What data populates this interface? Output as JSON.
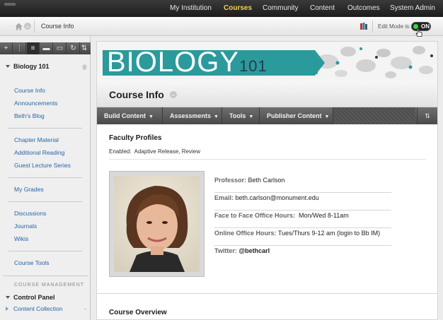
{
  "topnav": {
    "items": [
      "My Institution",
      "Courses",
      "Community",
      "Content",
      "Outcomes",
      "System Admin"
    ],
    "active_index": 1
  },
  "breadcrumb": {
    "title": "Course Info",
    "edit_mode_label": "Edit Mode is:",
    "edit_mode_state": "ON"
  },
  "sidebar": {
    "course_name": "Biology 101",
    "groups": [
      [
        "Course Info",
        "Announcements",
        "Beth's Blog"
      ],
      [
        "Chapter Material",
        "Additional Reading",
        "Guest Lecture Series"
      ],
      [
        "My Grades"
      ],
      [
        "Discussions",
        "Journals",
        "Wikis"
      ],
      [
        "Course Tools"
      ]
    ],
    "course_management_label": "COURSE MANAGEMENT",
    "control_panel": "Control Panel",
    "content_collection": "Content Collection"
  },
  "banner": {
    "title": "BIOLOGY",
    "number": "101"
  },
  "page": {
    "title": "Course Info",
    "actions": [
      "Build Content",
      "Assessments",
      "Tools",
      "Publisher Content"
    ],
    "faculty_title": "Faculty Profiles",
    "enabled_label": "Enabled:",
    "enabled_value": "Adaptive Release, Review",
    "overview_title": "Course Overview"
  },
  "profile": {
    "rows": [
      {
        "label": "Professor:",
        "value": "Beth Carlson"
      },
      {
        "label": "Email:",
        "value": "beth.carlson@monument.edu"
      },
      {
        "label": "Face to Face Office Hours:",
        "value": "Mon/Wed 8-11am"
      },
      {
        "label": "Online Office Hours:",
        "value": "Tues/Thurs 9-12 am (login to Bb IM)"
      },
      {
        "label": "Twitter:",
        "value": "@bethcarl"
      }
    ]
  },
  "colors": {
    "accent": "#f7d34a",
    "teal": "#2b9a9c",
    "link": "#2566a8",
    "toggle_on": "#39d444"
  }
}
